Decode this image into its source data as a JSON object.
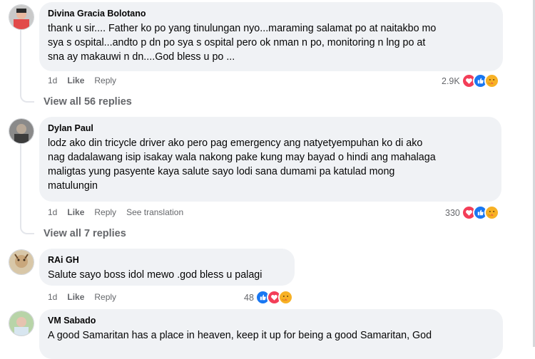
{
  "comments": [
    {
      "author": "Divina Gracia Bolotano",
      "text": "thank u sir.... Father ko po yang tinulungan nyo...maraming salamat po at naitakbo mo\nsya s ospital...andto p dn po sya s ospital pero ok nman n po, monitoring n lng po at\nsna ay makauwi n dn....God bless u po ...",
      "time": "1d",
      "like": "Like",
      "reply": "Reply",
      "reaction_count": "2.9K",
      "view_replies": "View all 56 replies"
    },
    {
      "author": "Dylan Paul",
      "text": "lodz ako din tricycle driver ako pero pag emergency ang natyetyempuhan ko di ako\nnag dadalawang isip isakay wala nakong pake kung may bayad o hindi ang mahalaga\nmaligtas yung pasyente kaya salute sayo lodi sana dumami pa katulad mong\nmatulungin",
      "time": "1d",
      "like": "Like",
      "reply": "Reply",
      "see_translation": "See translation",
      "reaction_count": "330",
      "view_replies": "View all 7 replies"
    },
    {
      "author": "RAi GH",
      "text": "Salute sayo boss idol mewo .god bless u palagi",
      "time": "1d",
      "like": "Like",
      "reply": "Reply",
      "reaction_count": "48"
    },
    {
      "author": "VM Sabado",
      "text": "A good Samaritan has a place in heaven, keep it up for being a good Samaritan, God"
    }
  ],
  "colors": {
    "bubble": "#f0f2f5",
    "meta": "#65676b",
    "love": "#f33e58",
    "like": "#1877f2",
    "care": "#f7b125"
  },
  "icons": [
    "love-icon",
    "like-icon",
    "care-icon"
  ]
}
